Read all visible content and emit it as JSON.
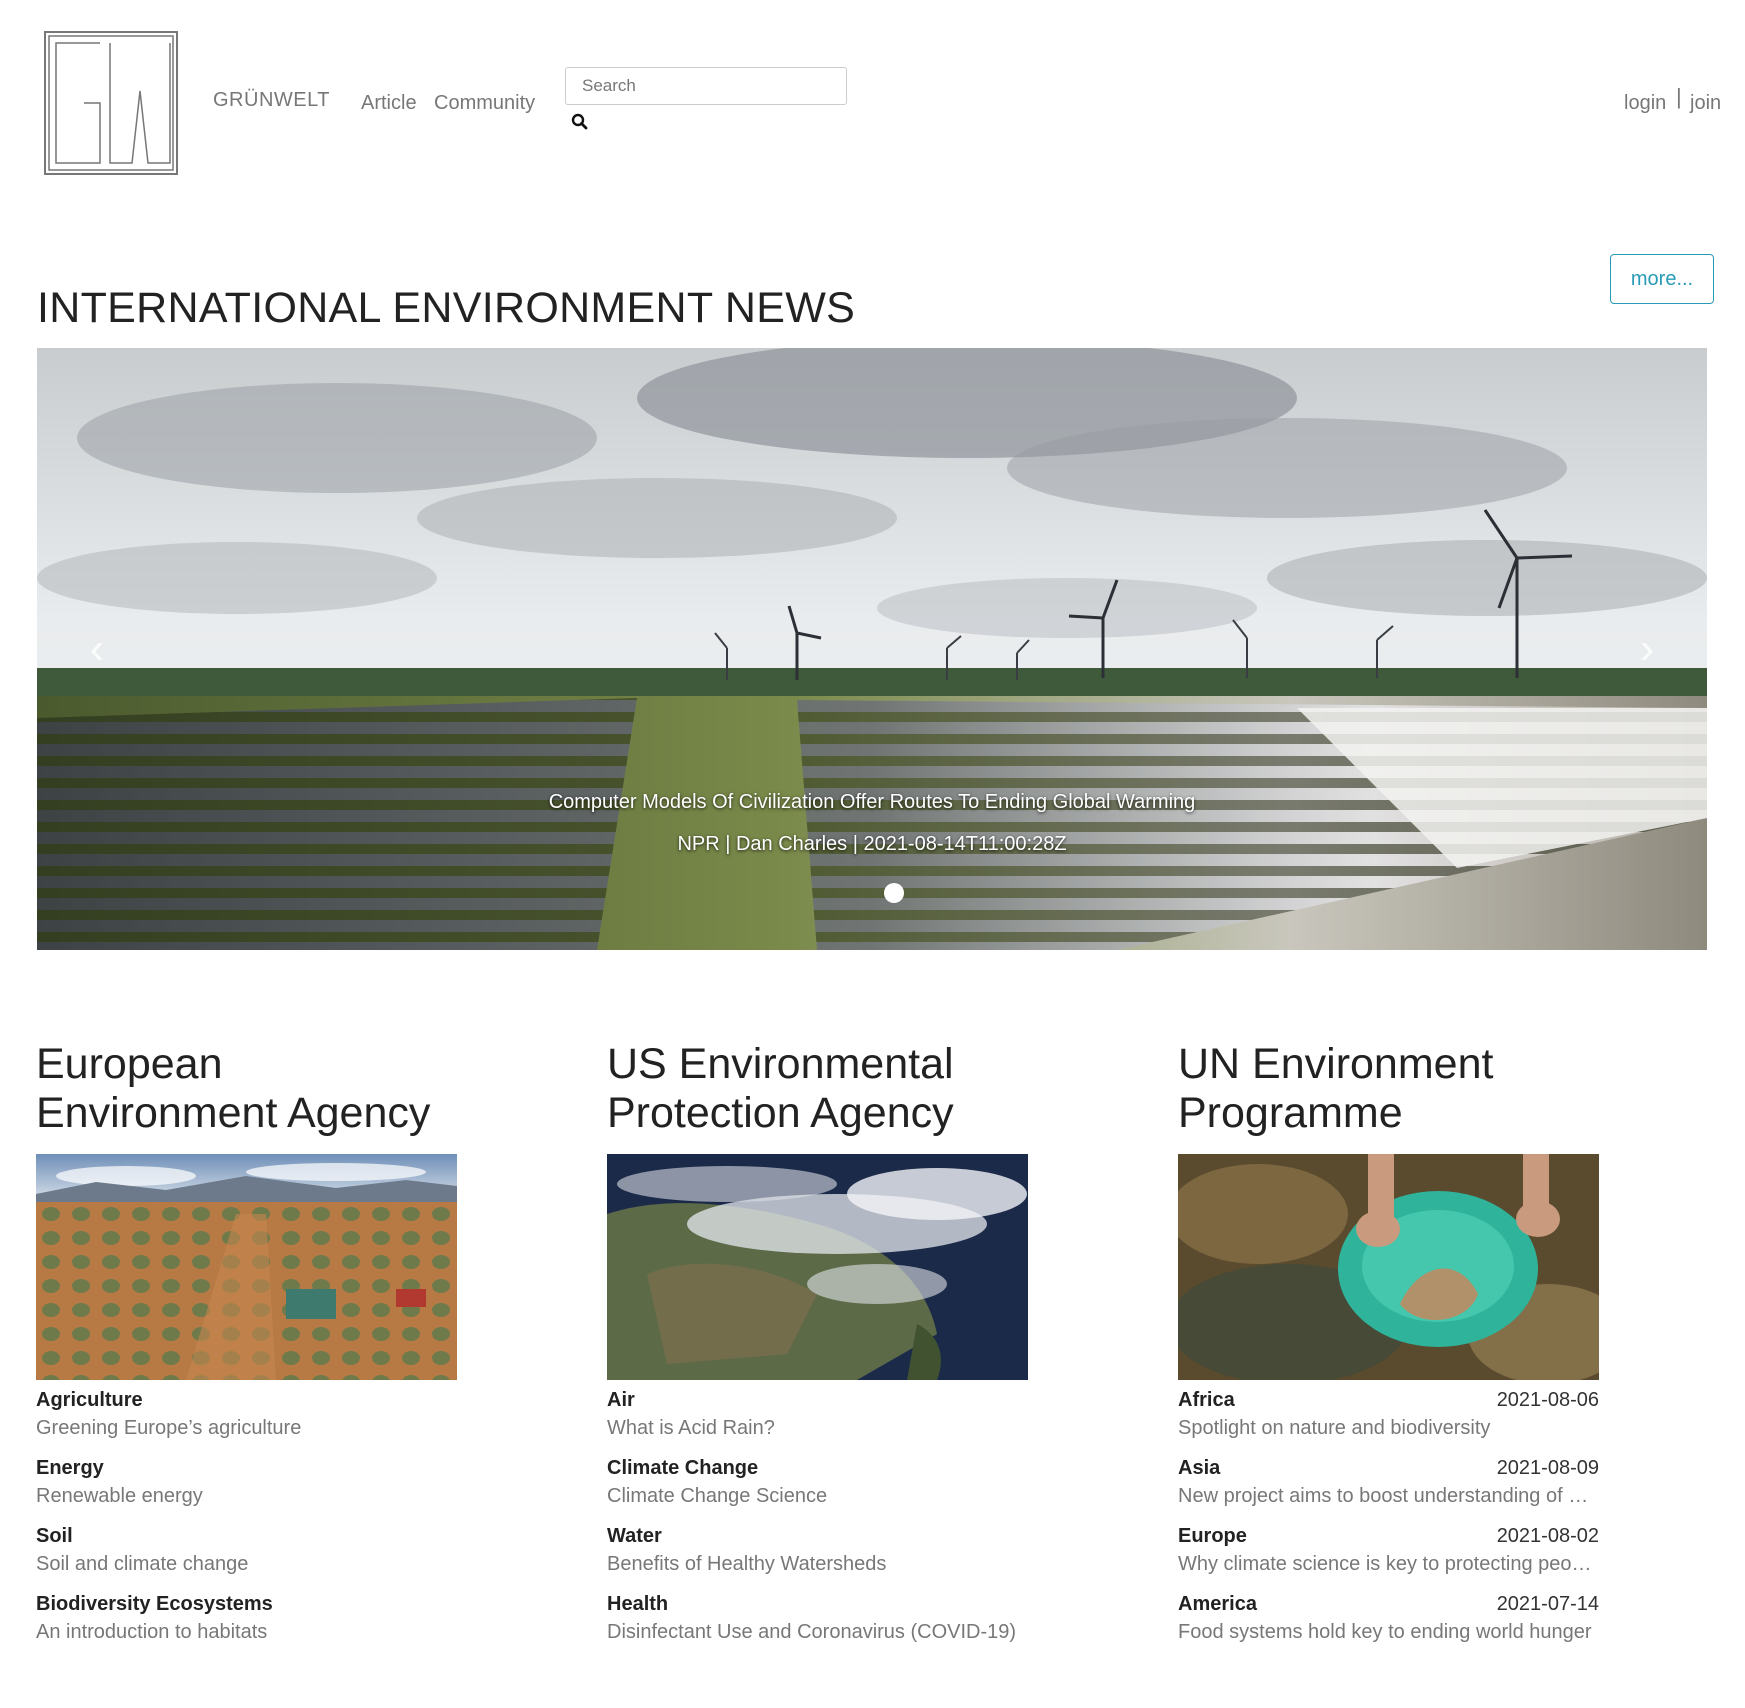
{
  "header": {
    "brand": "GRÜNWELT",
    "nav": {
      "article": "Article",
      "community": "Community"
    },
    "search_placeholder": "Search",
    "login": "login",
    "separator": "|",
    "join": "join"
  },
  "news": {
    "title": "INTERNATIONAL ENVIRONMENT NEWS",
    "more_label": "more...",
    "carousel": {
      "headline": "Computer Models Of Civilization Offer Routes To Ending Global Warming",
      "meta": "NPR | Dan Charles | 2021-08-14T11:00:28Z",
      "prev_icon": "chevron-left-icon",
      "next_icon": "chevron-right-icon"
    }
  },
  "columns": [
    {
      "title_line1": "European",
      "title_line2": "Environment Agency",
      "items": [
        {
          "topic": "Agriculture",
          "desc": "Greening Europe’s agriculture"
        },
        {
          "topic": "Energy",
          "desc": "Renewable energy"
        },
        {
          "topic": "Soil",
          "desc": "Soil and climate change"
        },
        {
          "topic": "Biodiversity Ecosystems",
          "desc": "An introduction to habitats"
        }
      ]
    },
    {
      "title_line1": "US Environmental",
      "title_line2": "Protection Agency",
      "items": [
        {
          "topic": "Air",
          "desc": "What is Acid Rain?"
        },
        {
          "topic": "Climate Change",
          "desc": "Climate Change Science"
        },
        {
          "topic": "Water",
          "desc": "Benefits of Healthy Watersheds"
        },
        {
          "topic": "Health",
          "desc": "Disinfectant Use and Coronavirus (COVID-19)"
        }
      ]
    },
    {
      "title_line1": "UN Environment",
      "title_line2": "Programme",
      "items": [
        {
          "topic": "Africa",
          "date": "2021-08-06",
          "desc": "Spotlight on nature and biodiversity"
        },
        {
          "topic": "Asia",
          "date": "2021-08-09",
          "desc": "New project aims to boost understanding of ocean health"
        },
        {
          "topic": "Europe",
          "date": "2021-08-02",
          "desc": "Why climate science is key to protecting people and planet"
        },
        {
          "topic": "America",
          "date": "2021-07-14",
          "desc": "Food systems hold key to ending world hunger"
        }
      ]
    }
  ]
}
